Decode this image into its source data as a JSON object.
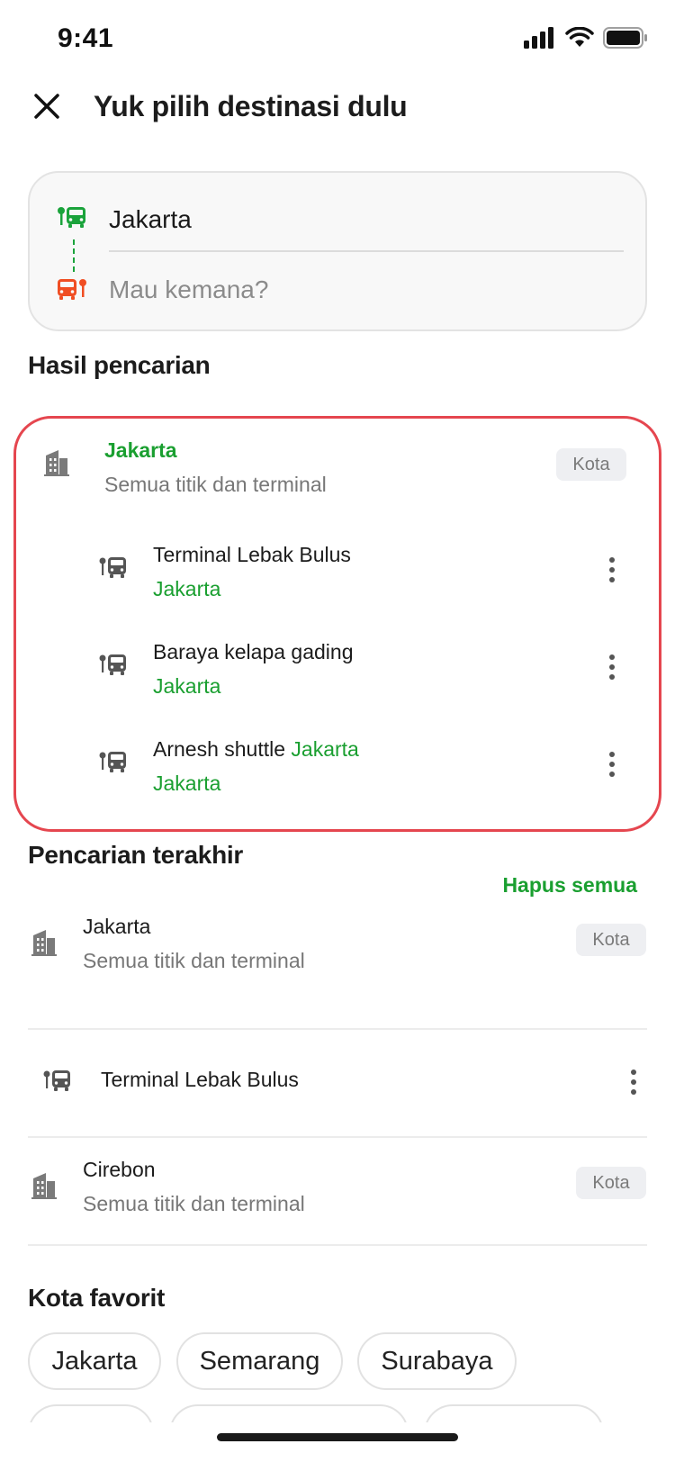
{
  "status_bar": {
    "time": "9:41"
  },
  "header": {
    "title": "Yuk pilih destinasi dulu"
  },
  "route": {
    "from_value": "Jakarta",
    "to_placeholder": "Mau kemana?"
  },
  "results": {
    "section_title": "Hasil pencarian",
    "city": {
      "name": "Jakarta",
      "subtitle": "Semua titik dan terminal",
      "badge": "Kota"
    },
    "terminals": [
      {
        "name": "Terminal Lebak Bulus",
        "name_suffix": "",
        "city": "Jakarta"
      },
      {
        "name": "Baraya kelapa gading",
        "name_suffix": "",
        "city": "Jakarta"
      },
      {
        "name": "Arnesh shuttle ",
        "name_suffix": "Jakarta",
        "city": "Jakarta"
      }
    ]
  },
  "recent": {
    "section_title": "Pencarian terakhir",
    "clear_all": "Hapus semua",
    "items": [
      {
        "title": "Jakarta",
        "subtitle": "Semua titik dan terminal",
        "badge": "Kota"
      },
      {
        "title": "Terminal Lebak Bulus"
      },
      {
        "title": "Cirebon",
        "subtitle": "Semua titik dan terminal",
        "badge": "Kota"
      }
    ]
  },
  "favorites": {
    "section_title": "Kota favorit",
    "chips": [
      "Jakarta",
      "Semarang",
      "Surabaya"
    ]
  },
  "colors": {
    "accent_green": "#1a9f30",
    "departure_icon": "#1aa33b",
    "arrival_icon": "#f04e23",
    "highlight_border": "#e5464f"
  }
}
